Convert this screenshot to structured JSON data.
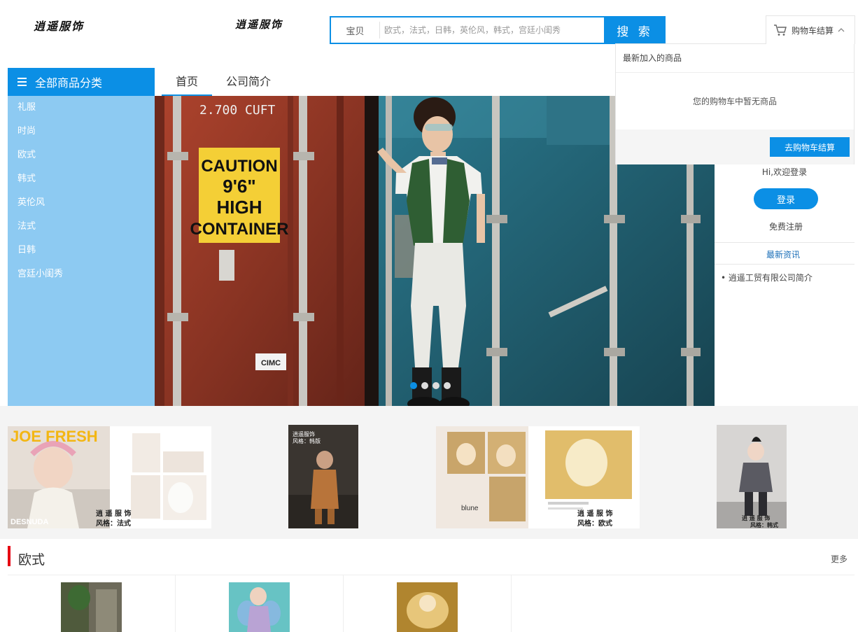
{
  "header": {
    "logo_left": "逍遥服饰",
    "logo_mid": "逍遥服饰",
    "search": {
      "type_label": "宝贝",
      "placeholder": "欧式，法式，日韩，英伦风，韩式，宫廷小闺秀",
      "button_label": "搜 索"
    },
    "cart": {
      "label": "购物车结算",
      "dropdown_title": "最新加入的商品",
      "empty_text": "您的购物车中暂无商品",
      "checkout_label": "去购物车结算"
    }
  },
  "categories": {
    "title": "全部商品分类",
    "items": [
      "礼服",
      "时尚",
      "欧式",
      "韩式",
      "英伦风",
      "法式",
      "日韩",
      "宫廷小闺秀"
    ]
  },
  "nav": {
    "items": [
      "首页",
      "公司简介"
    ],
    "active_index": 0
  },
  "banner": {
    "sign_line1": "CAUTION",
    "sign_line2": "9'6\"",
    "sign_line3": "HIGH",
    "sign_line4": "CONTAINER",
    "container_text": "2.700 CUFT",
    "brand_tag": "CIMC",
    "slide_count": 4,
    "active_slide": 0
  },
  "user": {
    "greeting": "Hi,欢迎登录",
    "login_label": "登录",
    "register_label": "免费注册",
    "news_title": "最新资讯",
    "news_items": [
      "逍遥工贸有限公司简介"
    ]
  },
  "promos": [
    {
      "headline": "JOE FRESH",
      "subline": "DESNUDA",
      "brand": "逍 遥 服 饰",
      "style": "风格：法式"
    },
    {
      "brand": "逍遥服饰",
      "style": "风格：韩版"
    },
    {
      "mini": "blune",
      "brand": "逍 遥 服 饰",
      "style": "风格：欧式"
    },
    {
      "brand": "逍 遥 服 饰",
      "style": "风格：韩式"
    }
  ],
  "section": {
    "title": "欧式",
    "more_label": "更多"
  },
  "colors": {
    "primary": "#0b8fe5",
    "category_bg": "#8dcaf2",
    "section_accent": "#e60012",
    "news_link": "#1b6fb8"
  }
}
